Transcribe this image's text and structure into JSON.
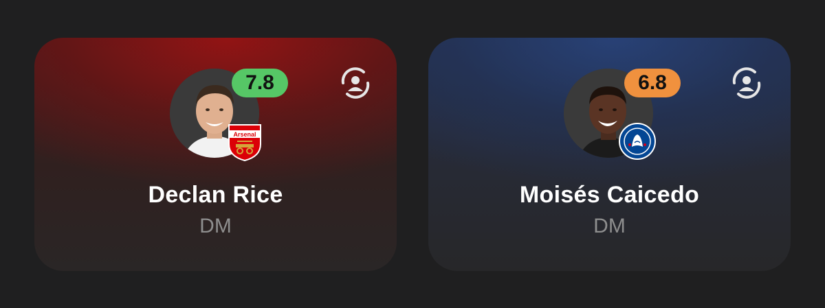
{
  "players": [
    {
      "name": "Declan Rice",
      "position": "DM",
      "rating": "7.8",
      "rating_color": "#56c766",
      "club": "Arsenal",
      "club_color": "#db0007",
      "crest_icon": "arsenal-crest-icon",
      "swap_icon": "swap-player-icon"
    },
    {
      "name": "Moisés Caicedo",
      "position": "DM",
      "rating": "6.8",
      "rating_color": "#f0913e",
      "club": "Chelsea",
      "club_color": "#034694",
      "crest_icon": "chelsea-crest-icon",
      "swap_icon": "swap-player-icon"
    }
  ]
}
